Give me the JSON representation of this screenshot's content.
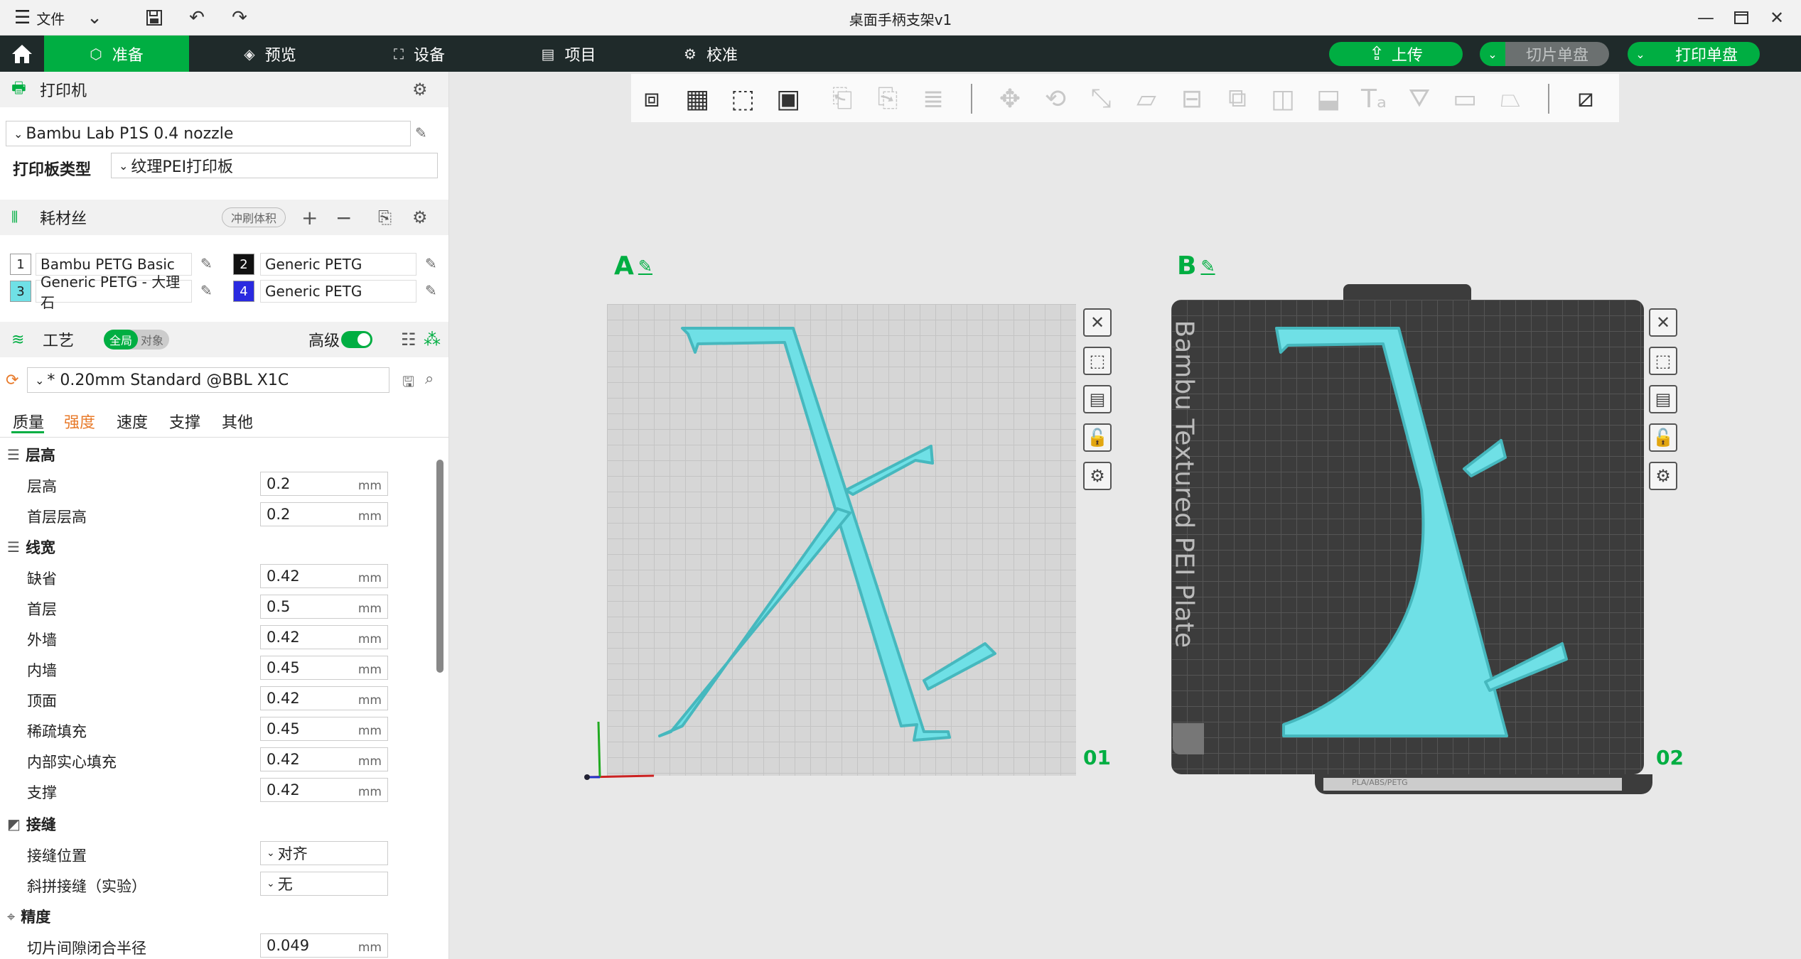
{
  "titlebar": {
    "menu_label": "文件",
    "title": "桌面手柄支架v1"
  },
  "nav": {
    "tabs": [
      {
        "label": "准备"
      },
      {
        "label": "预览"
      },
      {
        "label": "设备"
      },
      {
        "label": "项目"
      },
      {
        "label": "校准"
      }
    ],
    "upload_label": "上传",
    "slice_label": "切片单盘",
    "print_label": "打印单盘",
    "accent": "#00ae42"
  },
  "printer": {
    "section_label": "打印机",
    "name": "Bambu Lab P1S 0.4 nozzle",
    "plate_type_label": "打印板类型",
    "plate_type": "纹理PEI打印板"
  },
  "filament": {
    "section_label": "耗材丝",
    "flush_label": "冲刷体积",
    "items": [
      {
        "num": "1",
        "name": "Bambu PETG Basic",
        "color": "#ffffff"
      },
      {
        "num": "2",
        "name": "Generic PETG",
        "color": "#111111"
      },
      {
        "num": "3",
        "name": "Generic PETG - 大理石",
        "color": "#6fe0e6"
      },
      {
        "num": "4",
        "name": "Generic PETG",
        "color": "#2a2ae0"
      }
    ]
  },
  "process": {
    "section_label": "工艺",
    "global_label": "全局",
    "object_label": "对象",
    "advanced_label": "高级",
    "profile": "* 0.20mm Standard @BBL X1C",
    "tabs": [
      "质量",
      "强度",
      "速度",
      "支撑",
      "其他"
    ]
  },
  "groups": {
    "layer_height": {
      "title": "层高",
      "params": [
        {
          "label": "层高",
          "value": "0.2",
          "unit": "mm"
        },
        {
          "label": "首层层高",
          "value": "0.2",
          "unit": "mm"
        }
      ]
    },
    "line_width": {
      "title": "线宽",
      "params": [
        {
          "label": "缺省",
          "value": "0.42",
          "unit": "mm"
        },
        {
          "label": "首层",
          "value": "0.5",
          "unit": "mm"
        },
        {
          "label": "外墙",
          "value": "0.42",
          "unit": "mm"
        },
        {
          "label": "内墙",
          "value": "0.45",
          "unit": "mm"
        },
        {
          "label": "顶面",
          "value": "0.42",
          "unit": "mm"
        },
        {
          "label": "稀疏填充",
          "value": "0.45",
          "unit": "mm"
        },
        {
          "label": "内部实心填充",
          "value": "0.42",
          "unit": "mm"
        },
        {
          "label": "支撑",
          "value": "0.42",
          "unit": "mm"
        }
      ]
    },
    "seam": {
      "title": "接缝",
      "params": [
        {
          "label": "接缝位置",
          "value": "对齐"
        },
        {
          "label": "斜拼接缝（实验）",
          "value": "无"
        }
      ]
    },
    "precision": {
      "title": "精度",
      "params": [
        {
          "label": "切片间隙闭合半径",
          "value": "0.049",
          "unit": "mm"
        }
      ]
    }
  },
  "plates": {
    "a_label": "A",
    "a_num": "01",
    "b_label": "B",
    "b_num": "02",
    "b_plate_text": "Bambu Textured PEI Plate",
    "b_strip_text": "PLA/ABS/PETG",
    "model_color": "#6fe0e6"
  }
}
